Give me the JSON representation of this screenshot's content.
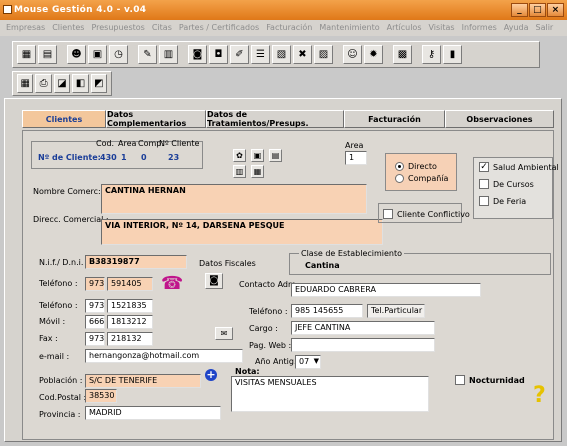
{
  "window": {
    "title": "Mouse Gestión 4.0  - v.04",
    "buttons": [
      "_",
      "□",
      "×"
    ]
  },
  "menu": [
    "Empresas",
    "Clientes",
    "Presupuestos",
    "Citas",
    "Partes / Certificados",
    "Facturación",
    "Mantenimiento",
    "Artículos",
    "Visitas",
    "Informes",
    "Ayuda",
    "Salir"
  ],
  "tabs": [
    "Clientes",
    "Datos Complementarios",
    "Datos de Tratamientos/Presups.",
    "Facturación",
    "Observaciones"
  ],
  "client_header": {
    "cod_label": "Cod.",
    "area_label": "Area",
    "comp_label": "Comp.",
    "ncliente_label": "Nº Cliente",
    "ndecliente_label": "Nº de Cliente:",
    "cod": "430",
    "area": "1",
    "comp": "0",
    "ncliente": "23"
  },
  "area_box": {
    "label": "Area",
    "value": "1"
  },
  "radio": {
    "options": [
      "Directo",
      "Compañía"
    ],
    "selected": "Directo"
  },
  "services": [
    {
      "label": "Salud Ambiental",
      "checked": true
    },
    {
      "label": "De Cursos",
      "checked": false
    },
    {
      "label": "De Feria",
      "checked": false
    }
  ],
  "nombre_comerc": {
    "label": "Nombre Comerc:",
    "value": "CANTINA HERNAN"
  },
  "direcc_comercial": {
    "label": "Direcc. Comercial :",
    "value": "VIA INTERIOR, Nº 14, DARSENA PESQUE"
  },
  "conflictivo": {
    "label": "Cliente Conflictivo",
    "checked": false
  },
  "nif": {
    "label": "N.i.f./ D.n.i. :",
    "value": "B38319877"
  },
  "datos_fiscales": "Datos Fiscales",
  "clase": {
    "label": "Clase de Establecimiento",
    "value": "Cantina"
  },
  "telefono1": {
    "label": "Teléfono :",
    "prefix": "973",
    "number": "591405"
  },
  "telefono2": {
    "label": "Teléfono :",
    "prefix": "973",
    "number": "1521835"
  },
  "movil": {
    "label": "Móvil :",
    "prefix": "666",
    "number": "1813212"
  },
  "fax": {
    "label": "Fax :",
    "prefix": "973",
    "number": "218132"
  },
  "email": {
    "label": "e-mail :",
    "value": "hernangonza@hotmail.com"
  },
  "contacto": {
    "label": "Contacto Adm :",
    "value": "EDUARDO CABRERA"
  },
  "telefono_contacto": {
    "label": "Teléfono :",
    "number": "985 145655",
    "tipo": "Tel.Particular"
  },
  "cargo": {
    "label": "Cargo :",
    "value": "JEFE CANTINA"
  },
  "pag_web": {
    "label": "Pag. Web :",
    "value": ""
  },
  "anio_antig": {
    "label": "Año Antig.:",
    "value": "07"
  },
  "poblacion": {
    "label": "Población :",
    "value": "S/C DE TENERIFE"
  },
  "cod_postal": {
    "label": "Cod.Postal :",
    "value": "38530"
  },
  "provincia": {
    "label": "Provincia :",
    "value": "MADRID"
  },
  "nota": {
    "label": "Nota:",
    "value": "VISITAS MENSUALES"
  },
  "nocturnidad": {
    "label": "Nocturnidad",
    "checked": false
  }
}
